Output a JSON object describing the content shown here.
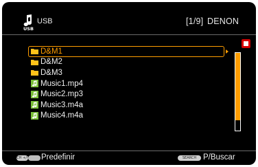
{
  "header": {
    "source_label": "USB",
    "page_indicator": "[1/9]",
    "brand": "DENON",
    "source_icon": "usb-music-note-icon"
  },
  "files": [
    {
      "name": "D&M1",
      "type": "folder",
      "selected": true
    },
    {
      "name": "D&M2",
      "type": "folder",
      "selected": false
    },
    {
      "name": "D&M3",
      "type": "folder",
      "selected": false
    },
    {
      "name": "Music1.mp4",
      "type": "music",
      "selected": false
    },
    {
      "name": "Music2.mp3",
      "type": "music",
      "selected": false
    },
    {
      "name": "Music3.m4a",
      "type": "music",
      "selected": false
    },
    {
      "name": "Music4.m4a",
      "type": "music",
      "selected": false
    }
  ],
  "scrollbar": {
    "thumb_fraction": 0.87
  },
  "footer": {
    "left_button": "CH +/-",
    "left_label": "Predefinir",
    "right_button": "SEARCH",
    "right_label": "P/Buscar"
  },
  "colors": {
    "background": "#000000",
    "accent": "#ff9d00",
    "folder": "#ffc21a",
    "music": "#7cc03a",
    "stop": "#d60000"
  }
}
